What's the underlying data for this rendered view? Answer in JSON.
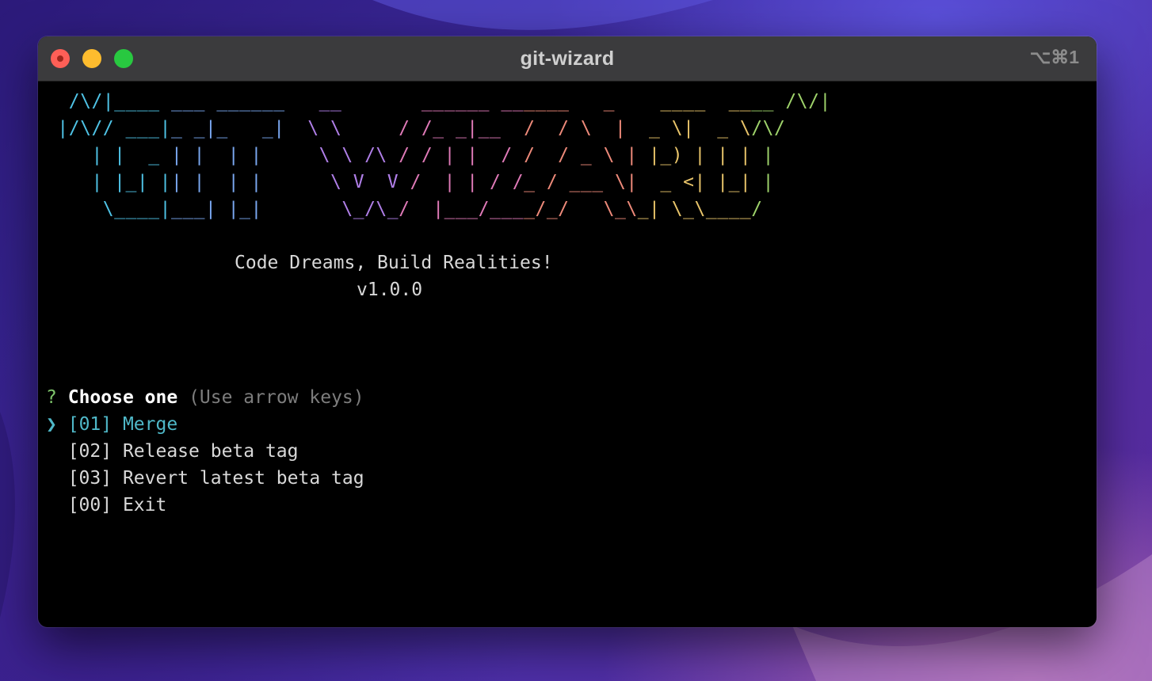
{
  "window": {
    "title": "git-wizard",
    "shortcut": "⌥⌘1"
  },
  "banner": {
    "art_lines": [
      "  /\\/|____ ___ ______   __       ______ ______   _    ____  ____ /\\/|",
      " |/\\// ___|_ _|_   _|  \\ \\     / /_ _|__  /  / \\  |  _ \\|  _ \\/\\/",
      "    | |  _ | |  | |     \\ \\ /\\ / / | |  / /  / _ \\ | |_) | | | |",
      "    | |_| || |  | |      \\ V  V /  | | / /_ / ___ \\|  _ <| |_| |",
      "     \\____|___| |_|       \\_/\\_/  |___/____/_/   \\_\\_| \\_\\____/"
    ],
    "tagline": "Code Dreams, Build Realities!",
    "version": "v1.0.0"
  },
  "prompt": {
    "marker": "?",
    "question": "Choose one",
    "hint": "(Use arrow keys)",
    "pointer": "❯"
  },
  "menu": {
    "items": [
      {
        "label": "[01] Merge",
        "selected": true
      },
      {
        "label": "[02] Release beta tag",
        "selected": false
      },
      {
        "label": "[03] Revert latest beta tag",
        "selected": false
      },
      {
        "label": "[00] Exit",
        "selected": false
      }
    ]
  },
  "colors": {
    "art_gradient": [
      "#4fc3e6",
      "#7aa7f0",
      "#b07fe8",
      "#e07ab8",
      "#ee8a7a",
      "#e8c46a",
      "#9fd36b"
    ],
    "prompt_marker": "#7ec46b",
    "selected_item": "#4fb8c8",
    "hint": "#7d7d7d"
  }
}
